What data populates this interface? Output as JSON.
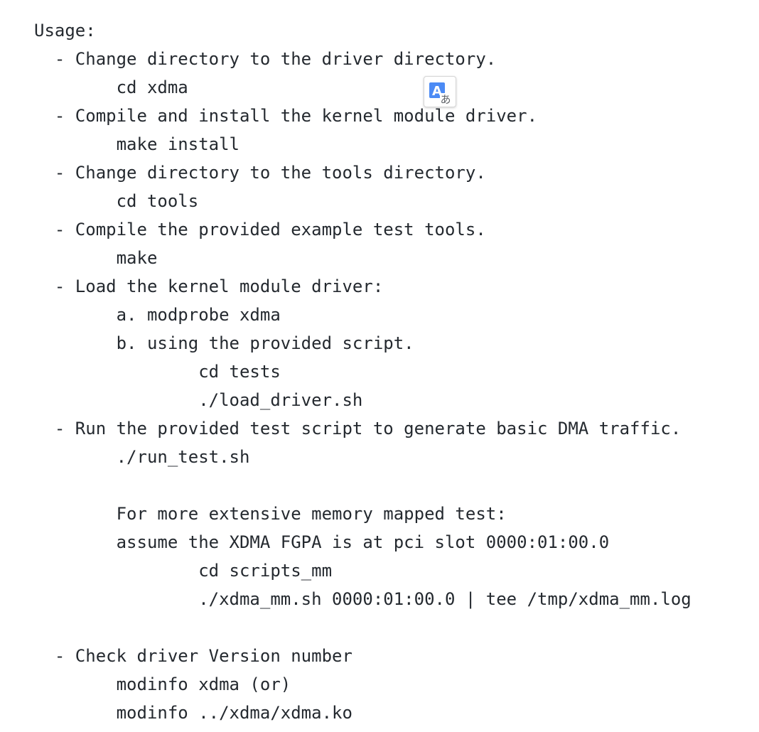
{
  "readme": {
    "lines": [
      "Usage:",
      "  - Change directory to the driver directory.",
      "        cd xdma",
      "  - Compile and install the kernel module driver.",
      "        make install",
      "  - Change directory to the tools directory.",
      "        cd tools",
      "  - Compile the provided example test tools.",
      "        make",
      "  - Load the kernel module driver:",
      "        a. modprobe xdma",
      "        b. using the provided script.",
      "                cd tests",
      "                ./load_driver.sh",
      "  - Run the provided test script to generate basic DMA traffic.",
      "        ./run_test.sh",
      "",
      "        For more extensive memory mapped test:",
      "        assume the XDMA FGPA is at pci slot 0000:01:00.0",
      "                cd scripts_mm",
      "                ./xdma_mm.sh 0000:01:00.0 | tee /tmp/xdma_mm.log",
      "",
      "  - Check driver Version number",
      "        modinfo xdma (or)",
      "        modinfo ../xdma/xdma.ko"
    ]
  },
  "translate_button": {
    "icon": "translate-icon",
    "glyph": "A",
    "glyph_secondary": "あ",
    "accent_color": "#4c8bf5",
    "secondary_color": "#5f6368"
  }
}
